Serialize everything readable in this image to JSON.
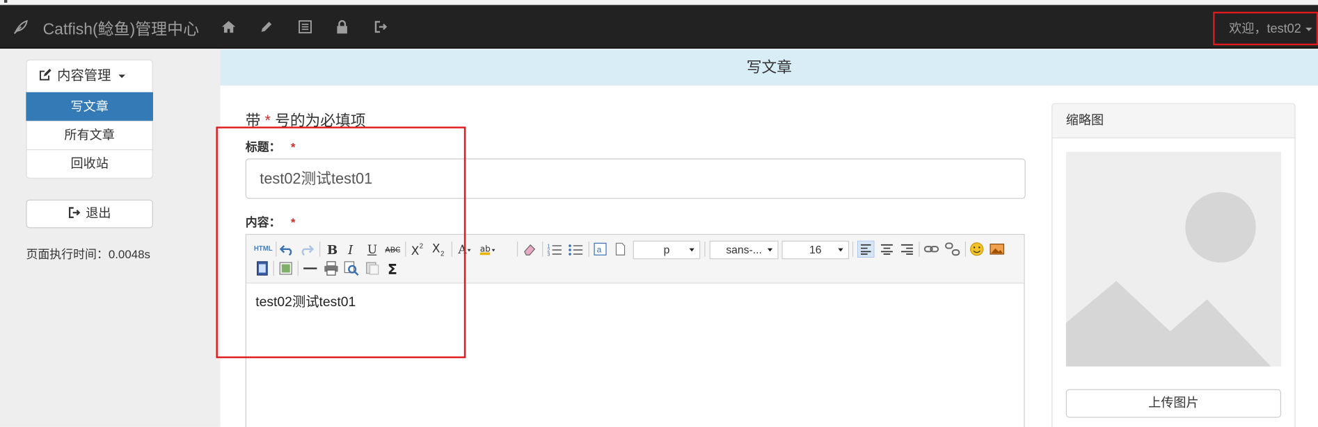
{
  "navbar": {
    "brand": "Catfish(鲶鱼)管理中心",
    "icons": [
      "feather-icon",
      "home-icon",
      "pencil-icon",
      "list-icon",
      "lock-icon",
      "logout-icon"
    ],
    "welcome": "欢迎，test02"
  },
  "sidebar": {
    "group_label": "内容管理",
    "items": [
      {
        "label": "写文章",
        "active": true
      },
      {
        "label": "所有文章",
        "active": false
      },
      {
        "label": "回收站",
        "active": false
      }
    ],
    "logout_label": "退出",
    "exec_time": "页面执行时间：0.0048s"
  },
  "main": {
    "header": "写文章",
    "required_note_prefix": "带",
    "required_star": "*",
    "required_note_suffix": "号的为必填项",
    "title_label": "标题：",
    "title_value": "test02测试test01",
    "content_label": "内容：",
    "content_value": "test02测试test01"
  },
  "editor_toolbar": {
    "html_label": "HTML",
    "paragraph_select": "p",
    "font_select": "sans-...",
    "size_select": "16"
  },
  "thumbnail": {
    "title": "缩略图",
    "upload_label": "上传图片"
  },
  "colors": {
    "navbar_bg": "#222222",
    "accent": "#337ab7",
    "header_bg": "#d9edf7",
    "annotation_red": "#e0191c"
  }
}
